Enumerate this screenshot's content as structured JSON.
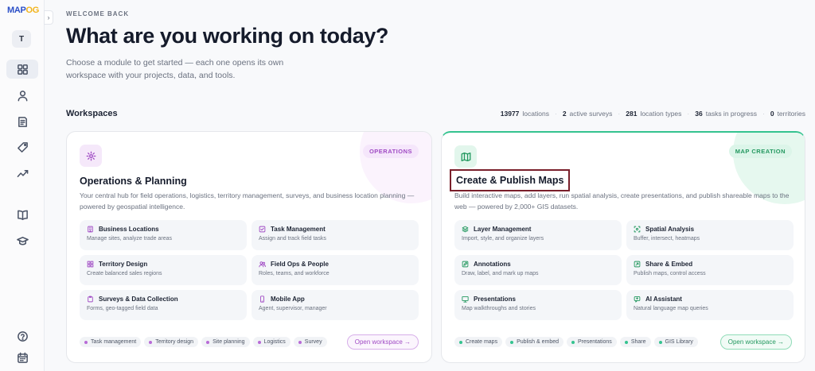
{
  "brand": {
    "logo_text": "MAP",
    "logo_accent": "OG"
  },
  "sidebar": {
    "avatar_initial": "T",
    "items": [
      {
        "name": "dashboard",
        "icon": "grid-icon",
        "active": true
      },
      {
        "name": "profile",
        "icon": "user-icon"
      },
      {
        "name": "reports",
        "icon": "document-icon"
      },
      {
        "name": "tags",
        "icon": "tag-icon"
      },
      {
        "name": "analytics",
        "icon": "trend-icon"
      },
      {
        "name": "library",
        "icon": "book-icon"
      },
      {
        "name": "learn",
        "icon": "graduation-cap-icon"
      },
      {
        "name": "help",
        "icon": "help-icon"
      },
      {
        "name": "calendar",
        "icon": "calendar-icon"
      }
    ]
  },
  "header": {
    "eyebrow": "WELCOME BACK",
    "title": "What are you working on today?",
    "subtitle": "Choose a module to get started — each one opens its own workspace with your projects, data, and tools."
  },
  "workspaces": {
    "title": "Workspaces",
    "stats": [
      {
        "value": "13977",
        "label": "locations"
      },
      {
        "value": "2",
        "label": "active surveys"
      },
      {
        "value": "281",
        "label": "location types"
      },
      {
        "value": "36",
        "label": "tasks in progress"
      },
      {
        "value": "0",
        "label": "territories"
      }
    ]
  },
  "ops_card": {
    "badge": "OPERATIONS",
    "title": "Operations & Planning",
    "description": "Your central hub for field operations, logistics, territory management, surveys, and business location planning — powered by geospatial intelligence.",
    "modules": [
      {
        "title": "Business Locations",
        "desc": "Manage sites, analyze trade areas"
      },
      {
        "title": "Task Management",
        "desc": "Assign and track field tasks"
      },
      {
        "title": "Territory Design",
        "desc": "Create balanced sales regions"
      },
      {
        "title": "Field Ops & People",
        "desc": "Roles, teams, and workforce"
      },
      {
        "title": "Surveys & Data Collection",
        "desc": "Forms, geo-tagged field data"
      },
      {
        "title": "Mobile App",
        "desc": "Agent, supervisor, manager"
      }
    ],
    "tags": [
      "Task management",
      "Territory design",
      "Site planning",
      "Logistics",
      "Survey"
    ],
    "button": "Open workspace →",
    "accent": "#a04bc4"
  },
  "maps_card": {
    "badge": "MAP CREATION",
    "title": "Create & Publish Maps",
    "description": "Build interactive maps, add layers, run spatial analysis, create presentations, and publish shareable maps to the web — powered by 2,000+ GIS datasets.",
    "modules": [
      {
        "title": "Layer Management",
        "desc": "Import, style, and organize layers"
      },
      {
        "title": "Spatial Analysis",
        "desc": "Buffer, intersect, heatmaps"
      },
      {
        "title": "Annotations",
        "desc": "Draw, label, and mark up maps"
      },
      {
        "title": "Share & Embed",
        "desc": "Publish maps, control access"
      },
      {
        "title": "Presentations",
        "desc": "Map walkthroughs and stories"
      },
      {
        "title": "AI Assistant",
        "desc": "Natural language map queries"
      }
    ],
    "tags": [
      "Create maps",
      "Publish & embed",
      "Presentations",
      "Share",
      "GIS Library"
    ],
    "button": "Open workspace →",
    "accent": "#23985f"
  }
}
